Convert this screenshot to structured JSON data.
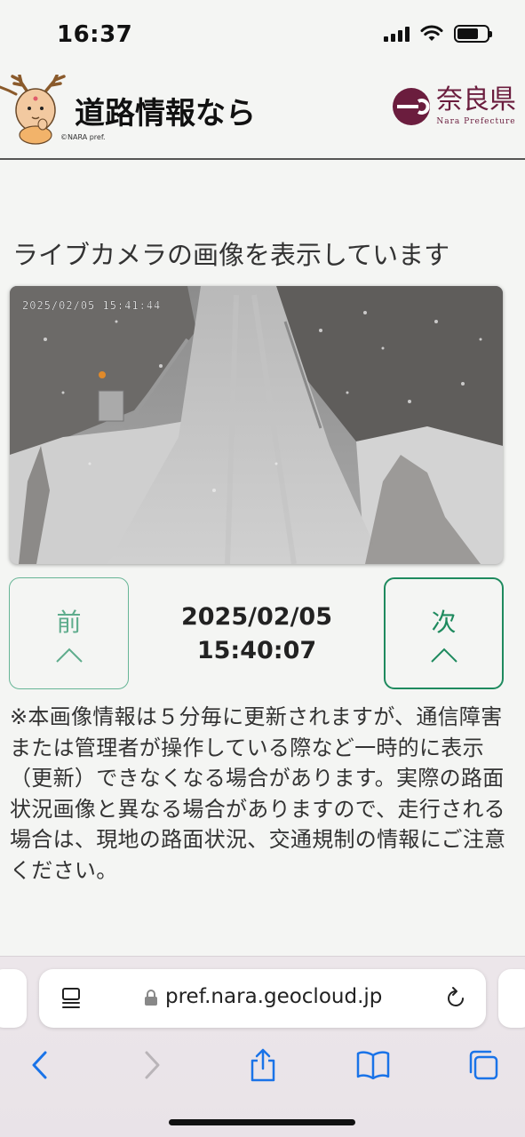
{
  "status_bar": {
    "time": "16:37"
  },
  "header": {
    "title": "道路情報なら",
    "mascot_credit": "©NARA pref.",
    "pref_name": "奈良県",
    "pref_subtitle": "Nara Prefecture"
  },
  "main": {
    "heading": "ライブカメラの画像を表示しています",
    "camera_overlay_text": "2025/02/05 15:41:44",
    "prev": {
      "label": "前",
      "sub": "へ"
    },
    "next": {
      "label": "次",
      "sub": "へ"
    },
    "timestamp_date": "2025/02/05",
    "timestamp_time": "15:40:07",
    "notice": "※本画像情報は５分毎に更新されますが、通信障害または管理者が操作している際など一時的に表示（更新）できなくなる場合があります。実際の路面状況画像と異なる場合がありますので、走行される場合は、現地の路面状況、交通規制の情報にご注意ください。"
  },
  "browser": {
    "url": "pref.nara.geocloud.jp",
    "icons": [
      "page-menu-icon",
      "lock-icon",
      "reload-icon",
      "back-icon",
      "forward-icon",
      "share-icon",
      "bookmarks-icon",
      "tabs-icon"
    ]
  },
  "colors": {
    "accent_green": "#1e8a5e",
    "accent_green_light": "#67b596",
    "pref_maroon": "#6b1d3e",
    "background": "#f4f5f3"
  }
}
